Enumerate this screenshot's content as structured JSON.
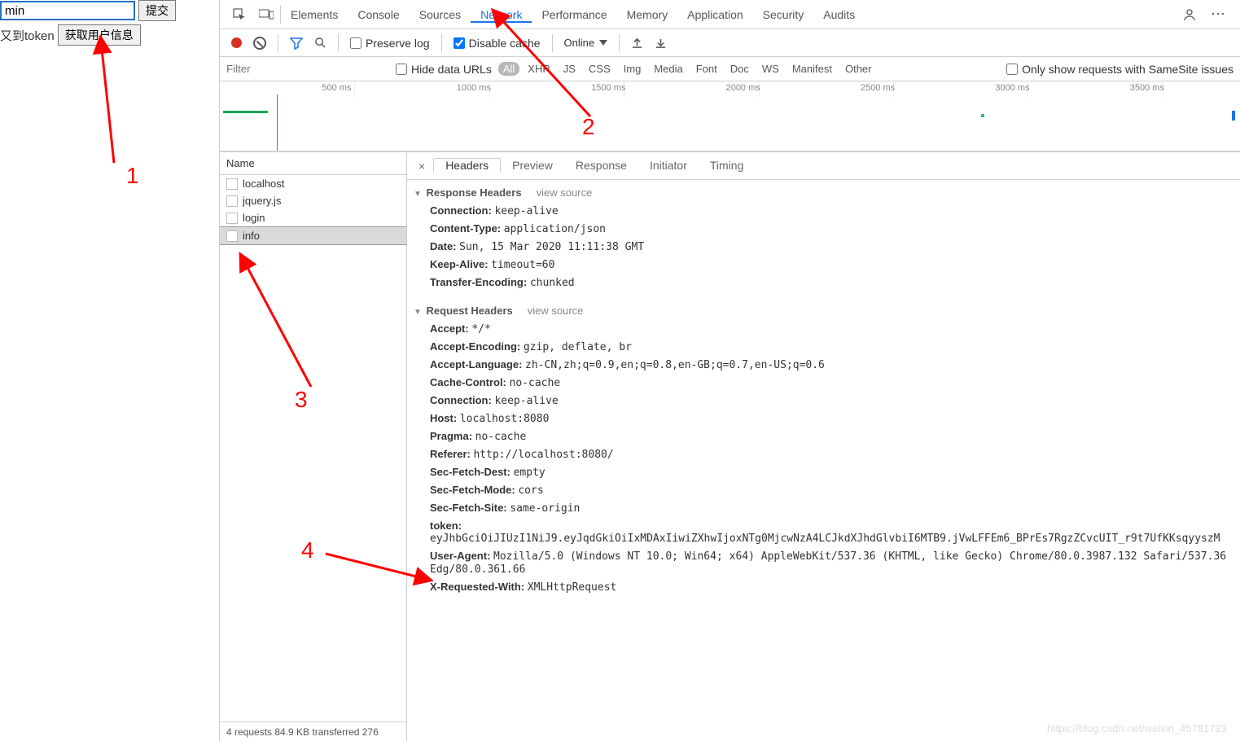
{
  "left": {
    "input_value": "min",
    "submit": "提交",
    "token_label": "又到token",
    "user_info_btn": "获取用户信息"
  },
  "annotations": {
    "a1": "1",
    "a2": "2",
    "a3": "3",
    "a4": "4"
  },
  "dev_tabs": [
    "Elements",
    "Console",
    "Sources",
    "Network",
    "Performance",
    "Memory",
    "Application",
    "Security",
    "Audits"
  ],
  "dev_active": "Network",
  "toolbar": {
    "preserve": "Preserve log",
    "disable_cache": "Disable cache",
    "online": "Online"
  },
  "filter": {
    "placeholder": "Filter",
    "hide_urls": "Hide data URLs",
    "pills": [
      "All",
      "XHR",
      "JS",
      "CSS",
      "Img",
      "Media",
      "Font",
      "Doc",
      "WS",
      "Manifest",
      "Other"
    ],
    "samesite": "Only show requests with SameSite issues"
  },
  "timeline": {
    "ticks": [
      "500 ms",
      "1000 ms",
      "1500 ms",
      "2000 ms",
      "2500 ms",
      "3000 ms",
      "3500 ms"
    ]
  },
  "name_header": "Name",
  "name_list": [
    "localhost",
    "jquery.js",
    "login",
    "info"
  ],
  "name_selected": "info",
  "status": "4 requests   84.9 KB transferred   276",
  "detail_tabs": [
    "Headers",
    "Preview",
    "Response",
    "Initiator",
    "Timing"
  ],
  "detail_active": "Headers",
  "response_headers_title": "Response Headers",
  "request_headers_title": "Request Headers",
  "view_source": "view source",
  "response_headers": [
    {
      "k": "Connection",
      "v": "keep-alive"
    },
    {
      "k": "Content-Type",
      "v": "application/json"
    },
    {
      "k": "Date",
      "v": "Sun, 15 Mar 2020 11:11:38 GMT"
    },
    {
      "k": "Keep-Alive",
      "v": "timeout=60"
    },
    {
      "k": "Transfer-Encoding",
      "v": "chunked"
    }
  ],
  "request_headers": [
    {
      "k": "Accept",
      "v": "*/*"
    },
    {
      "k": "Accept-Encoding",
      "v": "gzip, deflate, br"
    },
    {
      "k": "Accept-Language",
      "v": "zh-CN,zh;q=0.9,en;q=0.8,en-GB;q=0.7,en-US;q=0.6"
    },
    {
      "k": "Cache-Control",
      "v": "no-cache"
    },
    {
      "k": "Connection",
      "v": "keep-alive"
    },
    {
      "k": "Host",
      "v": "localhost:8080"
    },
    {
      "k": "Pragma",
      "v": "no-cache"
    },
    {
      "k": "Referer",
      "v": "http://localhost:8080/"
    },
    {
      "k": "Sec-Fetch-Dest",
      "v": "empty"
    },
    {
      "k": "Sec-Fetch-Mode",
      "v": "cors"
    },
    {
      "k": "Sec-Fetch-Site",
      "v": "same-origin"
    },
    {
      "k": "token",
      "v": "eyJhbGciOiJIUzI1NiJ9.eyJqdGkiOiIxMDAxIiwiZXhwIjoxNTg0MjcwNzA4LCJkdXJhdGlvbiI6MTB9.jVwLFFEm6_BPrEs7RgzZCvcUIT_r9t7UfKKsqyyszM"
    },
    {
      "k": "User-Agent",
      "v": "Mozilla/5.0 (Windows NT 10.0; Win64; x64) AppleWebKit/537.36 (KHTML, like Gecko) Chrome/80.0.3987.132 Safari/537.36 Edg/80.0.361.66"
    },
    {
      "k": "X-Requested-With",
      "v": "XMLHttpRequest"
    }
  ],
  "watermark": "https://blog.csdn.net/weixin_45781723"
}
